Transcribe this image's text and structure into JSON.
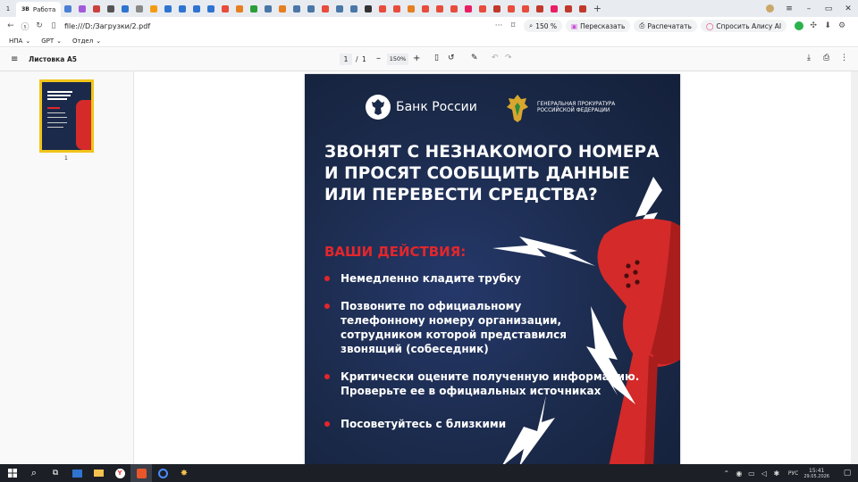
{
  "browser": {
    "tab_count": "1",
    "active_tab_label": "Работа",
    "active_tab_icon_text": "ЗВ",
    "url": "file:///D:/Загрузки/2.pdf",
    "zoom": "150 %",
    "retell_label": "Пересказать",
    "print_label": "Распечатать",
    "alice_label": "Спросить Алису AI",
    "tab_favicons": [
      "#4a7fd4",
      "#a15ad9",
      "#cc4040",
      "#555",
      "#2f74d0",
      "#888",
      "#f39c12",
      "#2f74d0",
      "#2f74d0",
      "#2f74d0",
      "#2f74d0",
      "#e74c3c",
      "#e67e22",
      "#2a9d3a",
      "#4a76a8",
      "#e67e22",
      "#4a76a8",
      "#4a76a8",
      "#e74c3c",
      "#4a76a8",
      "#4a76a8",
      "#333",
      "#e74c3c",
      "#e74c3c",
      "#e67e22",
      "#e74c3c",
      "#e74c3c",
      "#e74c3c",
      "#e91e63",
      "#e74c3c",
      "#c0392b",
      "#e74c3c",
      "#e74c3c",
      "#c0392b",
      "#e91e63",
      "#c0392b",
      "#c0392b"
    ]
  },
  "bookmarks": [
    {
      "label": "НПА"
    },
    {
      "label": "GPT"
    },
    {
      "label": "Отдел"
    }
  ],
  "pdf_toolbar": {
    "doc_title": "Листовка А5",
    "page_current": "1",
    "page_total": "1",
    "zoom": "150%"
  },
  "sidebar": {
    "thumb_page_label": "1"
  },
  "pdf_content": {
    "bank_name": "Банк России",
    "prosecutor_line1": "ГЕНЕРАЛЬНАЯ ПРОКУРАТУРА",
    "prosecutor_line2": "РОССИЙСКОЙ ФЕДЕРАЦИИ",
    "headline_lines": [
      "ЗВОНЯТ С НЕЗНАКОМОГО НОМЕРА",
      "И ПРОСЯТ СООБЩИТЬ ДАННЫЕ",
      "ИЛИ ПЕРЕВЕСТИ СРЕДСТВА?"
    ],
    "actions_title": "ВАШИ ДЕЙСТВИЯ:",
    "bullets": [
      {
        "lines": [
          "Немедленно кладите трубку"
        ]
      },
      {
        "lines": [
          "Позвоните по официальному",
          "телефонному номеру организации,",
          "сотрудником которой представился",
          "звонящий (собеседник)"
        ]
      },
      {
        "lines": [
          "Критически оцените полученную информацию.",
          "Проверьте ее в официальных источниках"
        ]
      },
      {
        "lines": [
          "Посоветуйтесь с близкими"
        ]
      }
    ],
    "colors": {
      "background": "#1b2a4a",
      "accent": "#e3262b",
      "text": "#ffffff"
    }
  },
  "taskbar": {
    "lang": "РУС",
    "time": "15:41",
    "date": "29.05.2026"
  }
}
